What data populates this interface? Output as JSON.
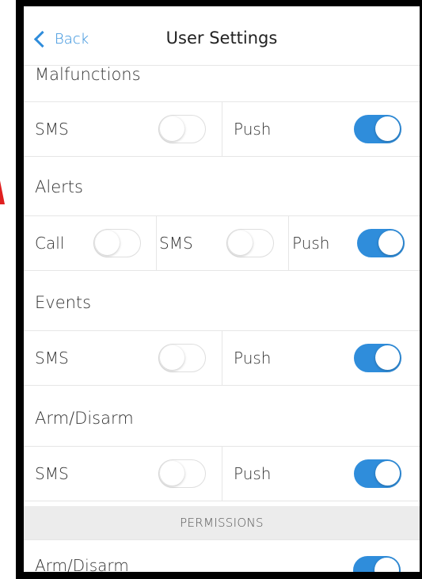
{
  "header": {
    "back_label": "Back",
    "title": "User Settings"
  },
  "sections": {
    "malfunctions": {
      "title": "Malfunctions",
      "sms_label": "SMS",
      "push_label": "Push",
      "sms_on": false,
      "push_on": true
    },
    "alerts": {
      "title": "Alerts",
      "call_label": "Call",
      "sms_label": "SMS",
      "push_label": "Push",
      "call_on": false,
      "sms_on": false,
      "push_on": true
    },
    "events": {
      "title": "Events",
      "sms_label": "SMS",
      "push_label": "Push",
      "sms_on": false,
      "push_on": true
    },
    "arm_disarm": {
      "title": "Arm/Disarm",
      "sms_label": "SMS",
      "push_label": "Push",
      "sms_on": false,
      "push_on": true
    }
  },
  "permissions": {
    "header": "PERMISSIONS",
    "arm_disarm_label": "Arm/Disarm",
    "arm_disarm_on": true
  },
  "colors": {
    "accent": "#2f8ddb",
    "divider": "#e6e6e6",
    "section_bar": "#ececec",
    "annotation": "#e02020"
  }
}
